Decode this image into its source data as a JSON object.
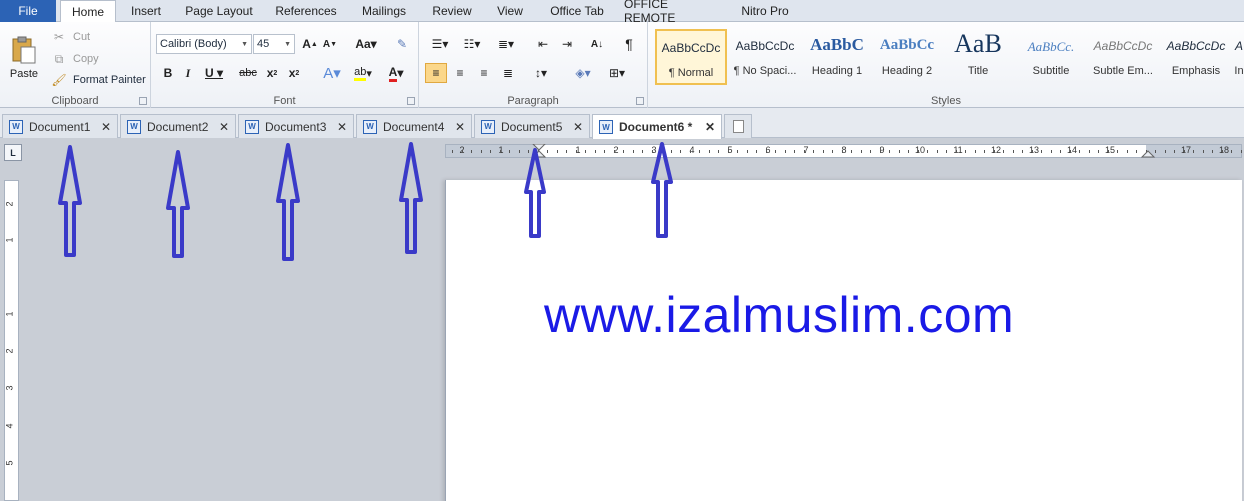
{
  "menu": {
    "file": "File",
    "tabs": [
      "Home",
      "Insert",
      "Page Layout",
      "References",
      "Mailings",
      "Review",
      "View",
      "Office Tab",
      "OFFICE REMOTE",
      "Nitro Pro"
    ]
  },
  "clipboard": {
    "paste": "Paste",
    "cut": "Cut",
    "copy": "Copy",
    "format_painter": "Format Painter",
    "label": "Clipboard"
  },
  "font": {
    "family": "Calibri (Body)",
    "size": "45",
    "label": "Font"
  },
  "paragraph": {
    "label": "Paragraph"
  },
  "styles": {
    "label": "Styles",
    "items": [
      {
        "sample": "AaBbCcDc",
        "name": "¶ Normal"
      },
      {
        "sample": "AaBbCcDc",
        "name": "¶ No Spaci..."
      },
      {
        "sample": "AaBbC",
        "name": "Heading 1"
      },
      {
        "sample": "AaBbCc",
        "name": "Heading 2"
      },
      {
        "sample": "AaB",
        "name": "Title"
      },
      {
        "sample": "AaBbCc.",
        "name": "Subtitle"
      },
      {
        "sample": "AaBbCcDc",
        "name": "Subtle Em..."
      },
      {
        "sample": "AaBbCcDc",
        "name": "Emphasis"
      },
      {
        "sample": "A",
        "name": "In"
      }
    ]
  },
  "doc_tabs": [
    "Document1",
    "Document2",
    "Document3",
    "Document4",
    "Document5",
    "Document6 *"
  ],
  "ruler": {
    "h_numbers": [
      "2",
      "1",
      "1",
      "2",
      "3",
      "4",
      "5",
      "6",
      "7",
      "8",
      "9",
      "10",
      "11",
      "12",
      "13",
      "14",
      "15",
      "17",
      "18"
    ],
    "v_numbers": [
      "2",
      "1",
      "1",
      "2",
      "3",
      "4",
      "5"
    ]
  },
  "document": {
    "text": "www.izalmuslim.com"
  },
  "colors": {
    "accent": "#2c63b5",
    "text_blue": "#1a1ae6",
    "arrow": "#3a3ac8"
  }
}
